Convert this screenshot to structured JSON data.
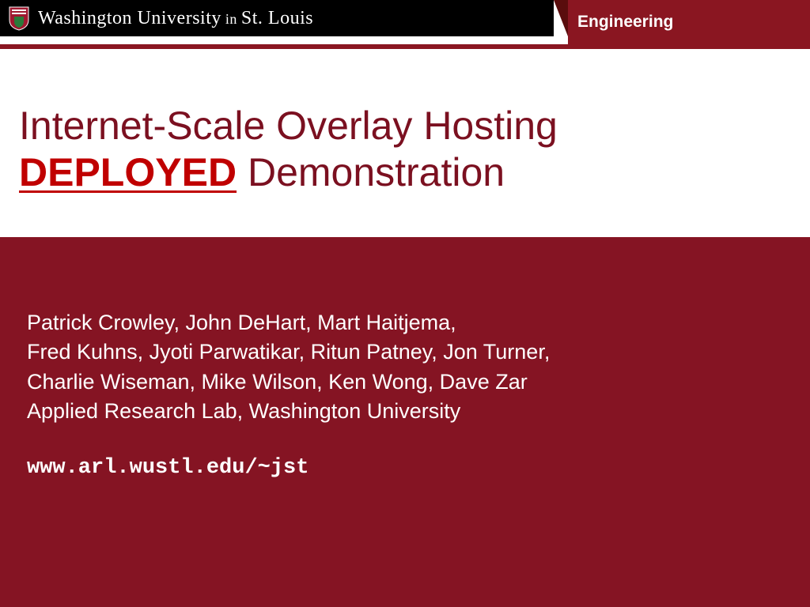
{
  "header": {
    "university": "Washington University in St. Louis",
    "university_prefix": "Washington University",
    "university_in": " in ",
    "university_suffix": "St. Louis",
    "tab_label": "Engineering"
  },
  "title": {
    "line1": "Internet-Scale Overlay Hosting",
    "emphasis": "DEPLOYED",
    "line2_rest": " Demonstration"
  },
  "authors": {
    "line1": "Patrick Crowley, John DeHart, Mart Haitjema,",
    "line2": "Fred Kuhns, Jyoti Parwatikar, Ritun Patney, Jon Turner,",
    "line3": "Charlie Wiseman, Mike Wilson, Ken Wong, Dave Zar",
    "line4": "Applied Research Lab, Washington University"
  },
  "url": "www.arl.wustl.edu/~jst"
}
